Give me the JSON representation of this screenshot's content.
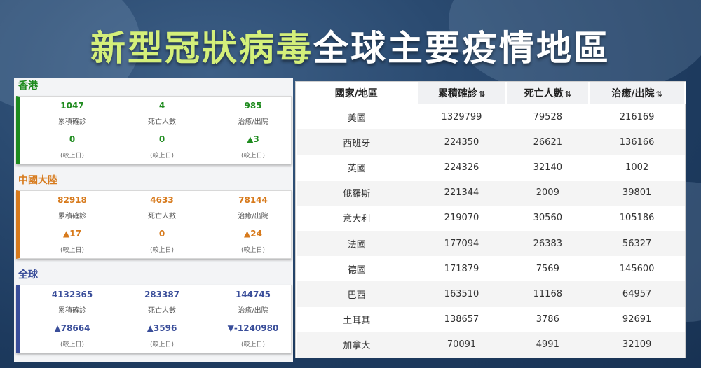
{
  "title": {
    "part1": "新型冠狀病毒",
    "part2": "全球主要疫情地區"
  },
  "colors": {
    "hongkong": "#1e8b1e",
    "mainland": "#d77a1c",
    "global": "#3a4e9a",
    "title_green": "#d4ef7a"
  },
  "regions": [
    {
      "name": "香港",
      "stats": [
        {
          "value": "1047",
          "label": "累積確診",
          "change": "0",
          "note": "(較上日)"
        },
        {
          "value": "4",
          "label": "死亡人數",
          "change": "0",
          "note": "(較上日)"
        },
        {
          "value": "985",
          "label": "治癒/出院",
          "change": "▲3",
          "note": "(較上日)"
        }
      ]
    },
    {
      "name": "中國大陸",
      "stats": [
        {
          "value": "82918",
          "label": "累積確診",
          "change": "▲17",
          "note": "(較上日)"
        },
        {
          "value": "4633",
          "label": "死亡人數",
          "change": "0",
          "note": "(較上日)"
        },
        {
          "value": "78144",
          "label": "治癒/出院",
          "change": "▲24",
          "note": "(較上日)"
        }
      ]
    },
    {
      "name": "全球",
      "stats": [
        {
          "value": "4132365",
          "label": "累積確診",
          "change": "▲78664",
          "note": "(較上日)"
        },
        {
          "value": "283387",
          "label": "死亡人數",
          "change": "▲3596",
          "note": "(較上日)"
        },
        {
          "value": "144745",
          "label": "治癒/出院",
          "change": "▼-1240980",
          "note": "(較上日)"
        }
      ]
    }
  ],
  "table": {
    "headers": [
      "國家/地區",
      "累積確診",
      "死亡人數",
      "治癒/出院"
    ],
    "sort_icon": "⇅",
    "rows": [
      [
        "美國",
        "1329799",
        "79528",
        "216169"
      ],
      [
        "西班牙",
        "224350",
        "26621",
        "136166"
      ],
      [
        "英國",
        "224326",
        "32140",
        "1002"
      ],
      [
        "俄羅斯",
        "221344",
        "2009",
        "39801"
      ],
      [
        "意大利",
        "219070",
        "30560",
        "105186"
      ],
      [
        "法國",
        "177094",
        "26383",
        "56327"
      ],
      [
        "德國",
        "171879",
        "7569",
        "145600"
      ],
      [
        "巴西",
        "163510",
        "11168",
        "64957"
      ],
      [
        "土耳其",
        "138657",
        "3786",
        "92691"
      ],
      [
        "加拿大",
        "70091",
        "4991",
        "32109"
      ]
    ]
  }
}
